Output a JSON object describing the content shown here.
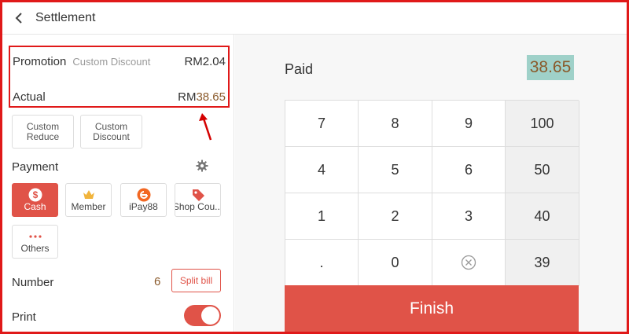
{
  "header": {
    "title": "Settlement"
  },
  "summary": {
    "promotion_label": "Promotion",
    "promotion_sub": "Custom Discount",
    "promotion_amount": "RM2.04",
    "actual_label": "Actual",
    "actual_currency": "RM",
    "actual_amount": "38.65"
  },
  "discount_buttons": {
    "reduce_line1": "Custom",
    "reduce_line2": "Reduce",
    "discount_line1": "Custom",
    "discount_line2": "Discount"
  },
  "payment": {
    "label": "Payment",
    "methods": [
      "Cash",
      "Member",
      "iPay88",
      "Shop Cou...",
      "Others"
    ],
    "selected": "Cash"
  },
  "number": {
    "label": "Number",
    "value": "6",
    "split_label": "Split bill"
  },
  "print": {
    "label": "Print",
    "enabled": true
  },
  "paid": {
    "label": "Paid",
    "value": "38.65"
  },
  "keypad": {
    "keys": [
      "7",
      "8",
      "9",
      "100",
      "4",
      "5",
      "6",
      "50",
      "1",
      "2",
      "3",
      "40",
      ".",
      "0",
      "",
      "39"
    ]
  },
  "finish_label": "Finish",
  "colors": {
    "accent": "#e05348",
    "highlight": "#9fd1c9",
    "amount": "#8a5a2b"
  },
  "icons": [
    "back-icon",
    "gear-icon",
    "cash-icon",
    "member-icon",
    "ipay88-icon",
    "shop-coupon-icon",
    "others-icon",
    "clear-icon"
  ]
}
